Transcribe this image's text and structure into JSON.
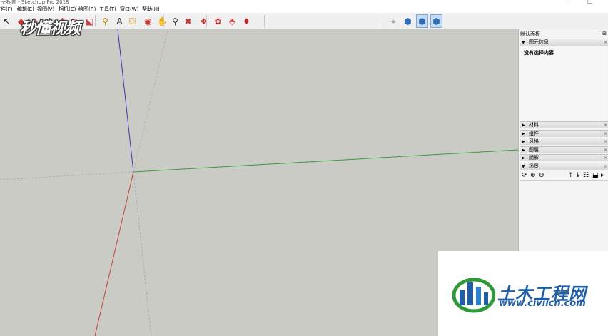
{
  "window": {
    "title": "无标题 - SketchUp Pro 2018",
    "minimize": "—",
    "maximize": "□"
  },
  "menu": [
    {
      "label": "文件(F)"
    },
    {
      "label": "编辑(E)"
    },
    {
      "label": "视图(V)"
    },
    {
      "label": "相机(C)"
    },
    {
      "label": "绘图(R)"
    },
    {
      "label": "工具(T)"
    },
    {
      "label": "窗口(W)"
    },
    {
      "label": "帮助(H)"
    }
  ],
  "watermark_top": "秒懂视频",
  "toolbar": {
    "tools": [
      {
        "name": "select-tool",
        "glyph": "↖"
      },
      {
        "name": "eraser-tool",
        "glyph": "◆"
      },
      {
        "name": "paint-tool",
        "glyph": "✎"
      },
      {
        "name": "line-tool",
        "glyph": "⁄"
      },
      {
        "name": "move-tool",
        "glyph": "✥"
      },
      {
        "name": "rotate-tool",
        "glyph": "⟳"
      },
      {
        "name": "scale-tool",
        "glyph": "⬕"
      },
      {
        "name": "tape-tool",
        "glyph": "⚲"
      },
      {
        "name": "text-tool",
        "glyph": "A"
      },
      {
        "name": "paint-bucket-tool",
        "glyph": "⛋"
      },
      {
        "name": "orbit-tool",
        "glyph": "◉"
      },
      {
        "name": "pan-tool",
        "glyph": "✋"
      },
      {
        "name": "zoom-tool",
        "glyph": "⚲"
      },
      {
        "name": "zoom-extents-tool",
        "glyph": "✖"
      },
      {
        "name": "warehouse-tool",
        "glyph": "❖"
      },
      {
        "name": "extension-tool",
        "glyph": "✿"
      },
      {
        "name": "share-tool",
        "glyph": "⬘"
      },
      {
        "name": "ruby-tool",
        "glyph": "♦"
      },
      {
        "name": "axes-tool",
        "glyph": "⌖"
      },
      {
        "name": "iso-view",
        "glyph": "⬢"
      },
      {
        "name": "top-view",
        "glyph": "⬢"
      },
      {
        "name": "front-view",
        "glyph": "⬢"
      }
    ]
  },
  "panel": {
    "title": "默认面板",
    "entity_info": {
      "label": "图元信息",
      "message": "没有选择内容"
    },
    "sections": [
      {
        "label": "材料",
        "arrow": "▶"
      },
      {
        "label": "组件",
        "arrow": "▶"
      },
      {
        "label": "风格",
        "arrow": "▶"
      },
      {
        "label": "图层",
        "arrow": "▶"
      },
      {
        "label": "阴影",
        "arrow": "▶"
      },
      {
        "label": "场景",
        "arrow": "▼"
      }
    ],
    "entity_arrow": "▼",
    "close": "×",
    "pin": "⊞"
  },
  "logo": {
    "name": "土木工程网",
    "url": "www.civilcn.com"
  },
  "colors": {
    "viewport": "#cbcbc6",
    "axis_red": "#c0453a",
    "axis_green": "#3a9a3a",
    "axis_blue": "#3a3ab0",
    "logo_blue": "#1f5ea6"
  }
}
